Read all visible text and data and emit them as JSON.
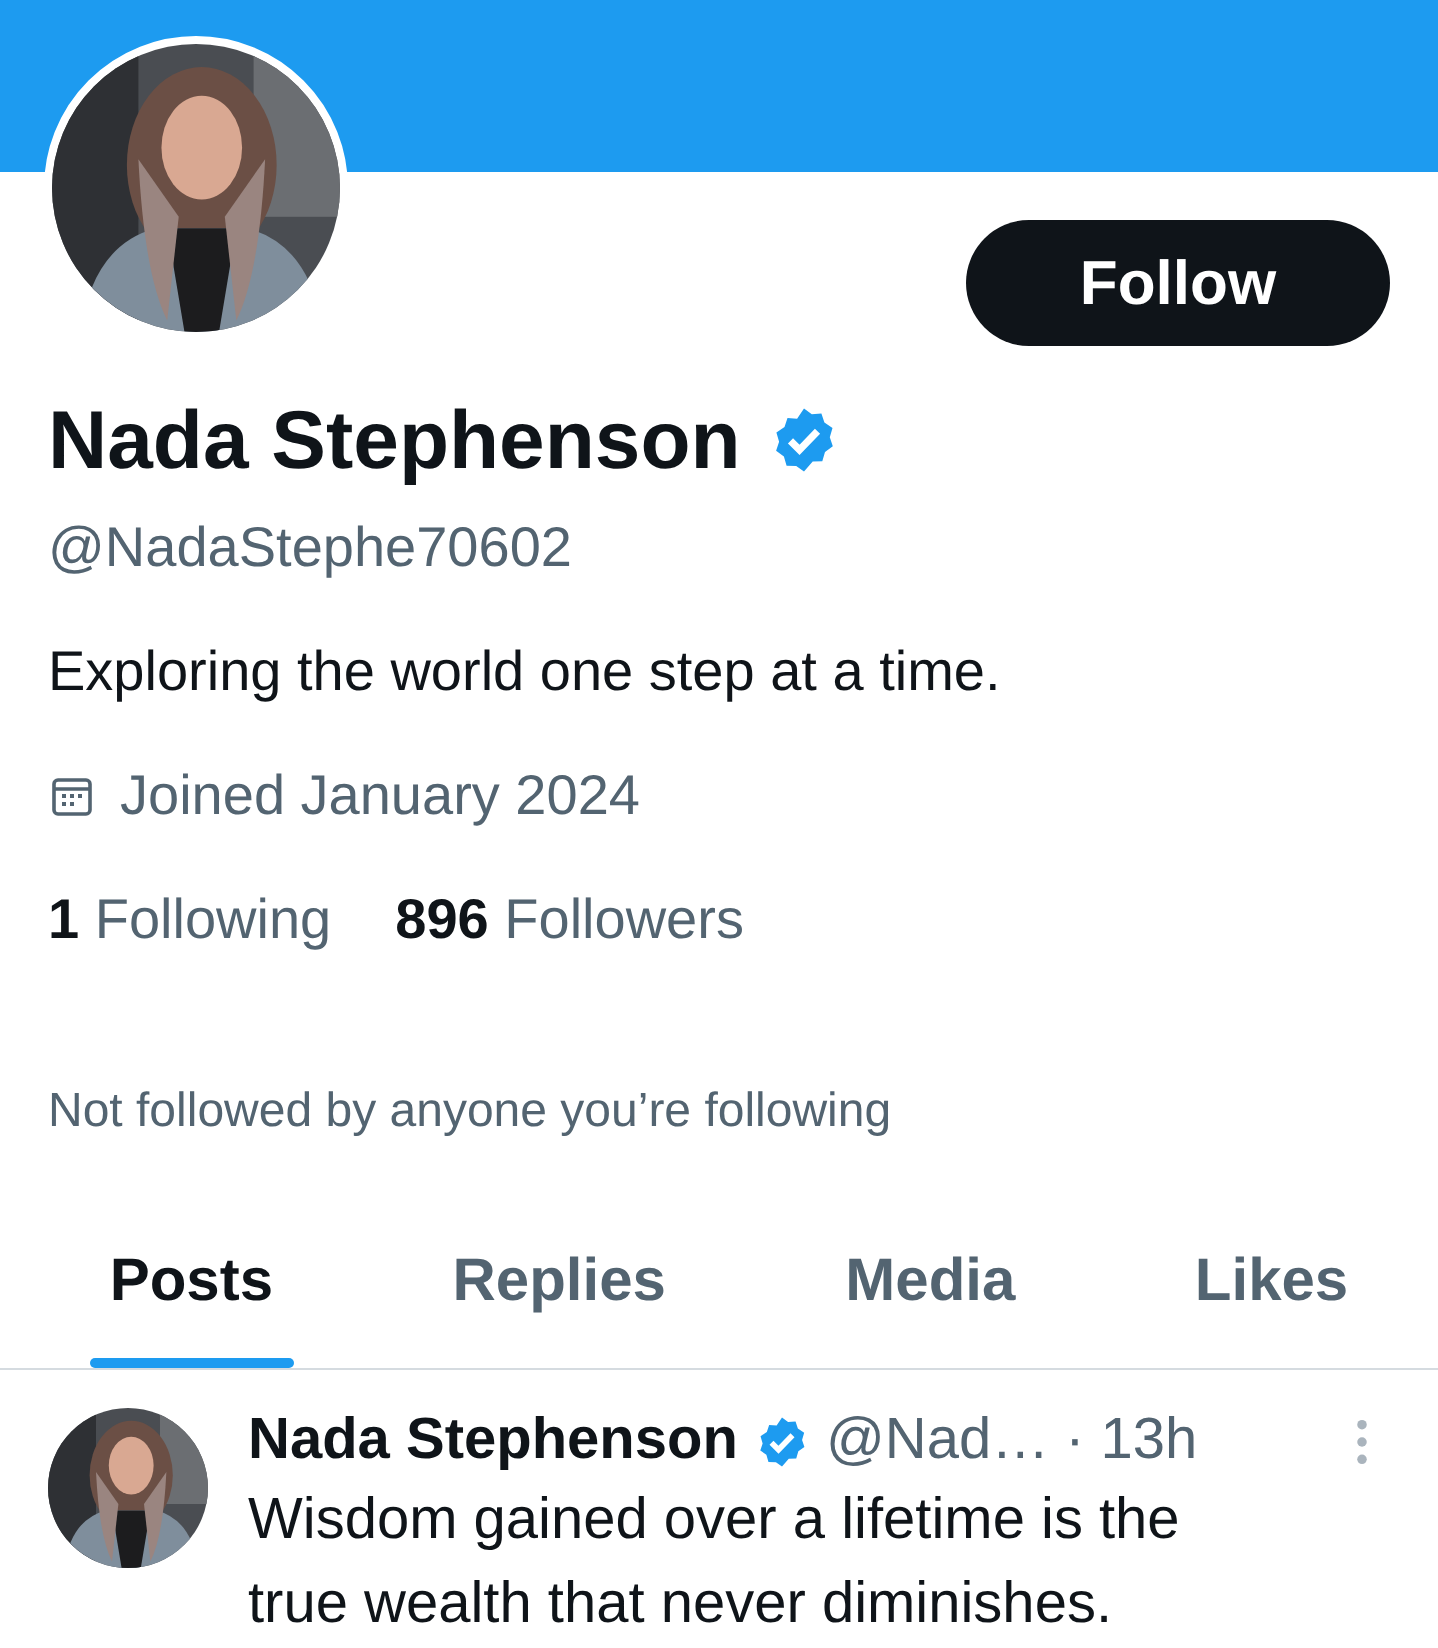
{
  "banner": {
    "kind": "solid"
  },
  "profile": {
    "follow_button": "Follow",
    "name": "Nada Stephenson",
    "verified": true,
    "handle": "@NadaStephe70602",
    "bio": "Exploring the world one step at a time.",
    "joined": "Joined January 2024",
    "stats": [
      {
        "count": "1",
        "label": "Following"
      },
      {
        "count": "896",
        "label": "Followers"
      }
    ],
    "followed_by": "Not followed by anyone you’re following"
  },
  "tabs": [
    {
      "label": "Posts",
      "selected": true
    },
    {
      "label": "Replies",
      "selected": false
    },
    {
      "label": "Media",
      "selected": false
    },
    {
      "label": "Likes",
      "selected": false
    }
  ],
  "posts": [
    {
      "name": "Nada Stephenson",
      "verified": true,
      "handle": "@Nad…",
      "time": "· 13h",
      "text": "Wisdom gained over a lifetime is the true wealth that never diminishes."
    }
  ]
}
